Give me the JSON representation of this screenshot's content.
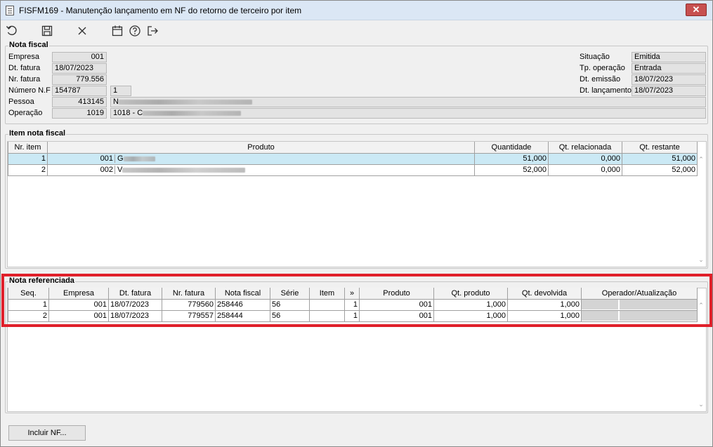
{
  "window": {
    "title": "FISFM169 - Manutenção lançamento em NF do retorno de terceiro por item",
    "close_label": "✕"
  },
  "toolbar": [
    "undo-icon",
    "save-icon",
    "cancel-icon",
    "calendar-icon",
    "help-icon",
    "exit-icon"
  ],
  "nota_fiscal": {
    "title": "Nota fiscal",
    "empresa_label": "Empresa",
    "empresa": "001",
    "dt_fatura_label": "Dt. fatura",
    "dt_fatura": "18/07/2023",
    "nr_fatura_label": "Nr. fatura",
    "nr_fatura": "779.556",
    "numero_nf_label": "Número N.F",
    "numero_nf": "154787",
    "serie": "1",
    "pessoa_label": "Pessoa",
    "pessoa_code": "413145",
    "pessoa_name": "N",
    "operacao_label": "Operação",
    "operacao_code": "1019",
    "operacao_desc": "1018 - C",
    "situacao_label": "Situação",
    "situacao": "Emitida",
    "tp_operacao_label": "Tp. operação",
    "tp_operacao": "Entrada",
    "dt_emissao_label": "Dt. emissão",
    "dt_emissao": "18/07/2023",
    "dt_lancamento_label": "Dt. lançamento",
    "dt_lancamento": "18/07/2023"
  },
  "itens": {
    "title": "Item nota fiscal",
    "columns": [
      "Nr. item",
      "Produto",
      "Quantidade",
      "Qt. relacionada",
      "Qt. restante"
    ],
    "rows": [
      {
        "nr": "1",
        "produto": "001",
        "desc": "G",
        "quantidade": "51,000",
        "relacionada": "0,000",
        "restante": "51,000"
      },
      {
        "nr": "2",
        "produto": "002",
        "desc": "V",
        "quantidade": "52,000",
        "relacionada": "0,000",
        "restante": "52,000"
      }
    ]
  },
  "referenciada": {
    "title": "Nota referenciada",
    "columns": [
      "Seq.",
      "Empresa",
      "Dt. fatura",
      "Nr. fatura",
      "Nota fiscal",
      "Série",
      "Item",
      "»",
      "Produto",
      "Qt. produto",
      "Qt. devolvida",
      "Operador/Atualização"
    ],
    "rows": [
      {
        "seq": "1",
        "empresa": "001",
        "dt_fatura": "18/07/2023",
        "nr_fatura": "779560",
        "nota_fiscal": "258446",
        "serie": "56",
        "item": "",
        "x": "1",
        "produto": "001",
        "qt_produto": "1,000",
        "qt_devolvida": "1,000"
      },
      {
        "seq": "2",
        "empresa": "001",
        "dt_fatura": "18/07/2023",
        "nr_fatura": "779557",
        "nota_fiscal": "258444",
        "serie": "56",
        "item": "",
        "x": "1",
        "produto": "001",
        "qt_produto": "1,000",
        "qt_devolvida": "1,000"
      }
    ]
  },
  "buttons": {
    "incluir_nf": "Incluir NF..."
  },
  "colors": {
    "highlight": "#e0202a",
    "selected_row": "#cbe9f5",
    "titlebar": "#dbe7f5"
  }
}
